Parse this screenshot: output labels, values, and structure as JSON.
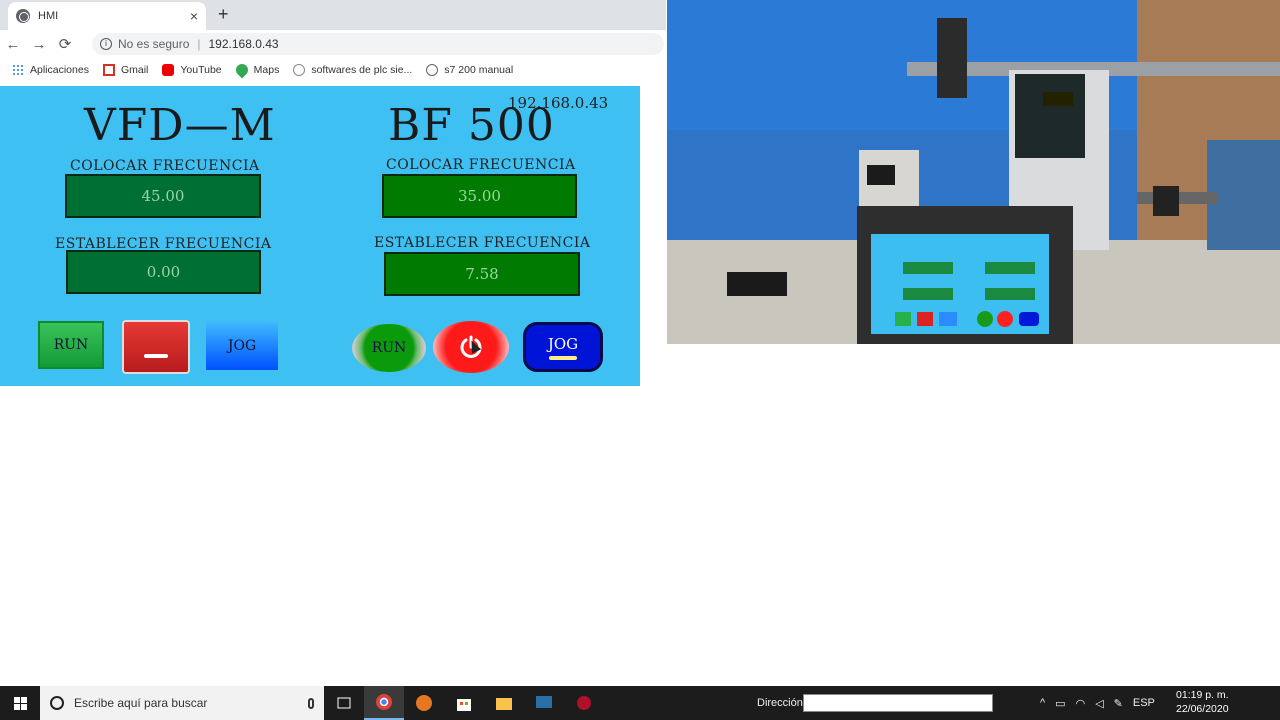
{
  "browser": {
    "tab_title": "HMI",
    "tab_close": "×",
    "new_tab": "+",
    "nav": {
      "back": "←",
      "forward": "→",
      "reload": "⟳"
    },
    "security_label": "No es seguro",
    "url": "192.168.0.43",
    "bookmarks": [
      {
        "label": "Aplicaciones",
        "icon": "apps-icon"
      },
      {
        "label": "Gmail",
        "icon": "gmail-icon"
      },
      {
        "label": "YouTube",
        "icon": "youtube-icon"
      },
      {
        "label": "Maps",
        "icon": "maps-icon"
      },
      {
        "label": "softwares de plc sie...",
        "icon": "site-icon"
      },
      {
        "label": "s7 200 manual",
        "icon": "site-icon"
      }
    ]
  },
  "hmi": {
    "ip": "192.168.0.43",
    "vfd": {
      "title": "VFD—M",
      "set_label": "COLOCAR FRECUENCIA",
      "set_value": "45.00",
      "est_label": "ESTABLECER FRECUENCIA",
      "est_value": "0.00",
      "run_label": "RUN",
      "jog_label": "JOG"
    },
    "bf": {
      "title": "BF 500",
      "set_label": "COLOCAR FRECUENCIA",
      "set_value": "35.00",
      "est_label": "ESTABLECER FRECUENCIA",
      "est_value": "7.58",
      "run_label": "RUN",
      "jog_label": "JOG"
    }
  },
  "taskbar": {
    "search_placeholder": "Escribe aquí para buscar",
    "address_label": "Dirección",
    "language": "ESP",
    "time": "01:19 p. m.",
    "date": "22/06/2020"
  },
  "colors": {
    "hmi_background": "#3ec0f2",
    "value_box_green": "#006f33",
    "jog_blue": "#0014d8",
    "stop_red": "#ff1a1a"
  }
}
